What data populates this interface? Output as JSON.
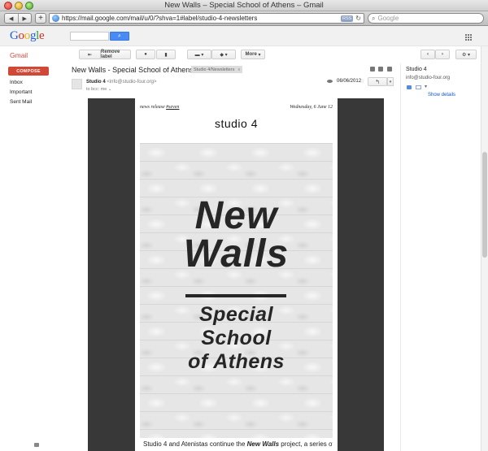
{
  "window": {
    "title": "New Walls – Special School of Athens – Gmail"
  },
  "browser": {
    "back_icon": "triangle-left-icon",
    "forward_icon": "triangle-right-icon",
    "url": "https://mail.google.com/mail/u/0/?shva=1#label/studio-4-newsletters",
    "rss_label": "RSS",
    "search_placeholder": "Google"
  },
  "google": {
    "logo": [
      "G",
      "o",
      "o",
      "g",
      "l",
      "e"
    ]
  },
  "gmail": {
    "app_label": "Gmail",
    "toolbar": {
      "remove_label": "Remove label",
      "more_label": "More"
    },
    "sidebar": {
      "compose_label": "COMPOSE",
      "items": [
        {
          "label": "Inbox"
        },
        {
          "label": "Important"
        },
        {
          "label": "Sent Mail"
        }
      ]
    },
    "message": {
      "subject": "New Walls - Special School of Athens",
      "label_chip": "Studio 4/Newsletters",
      "label_chip_close": "x",
      "sender_name": "Studio 4",
      "sender_email": "<info@studio-four.org>",
      "recipients": "to bcc: me",
      "date": "06/06/2012"
    },
    "contact": {
      "name": "Studio 4",
      "email": "info@studio-four.org",
      "details_link": "Show details"
    }
  },
  "newsletter": {
    "kicker_prefix": "news release ",
    "kicker_number": "#seven",
    "date_line": "Wednesday, 6 June 12",
    "logo_text": "studio 4",
    "headline_1a": "New",
    "headline_1b": "Walls",
    "headline_2a": "Special",
    "headline_2b": "School",
    "headline_2c": "of Athens",
    "body_lead": "Studio 4 and Atenistas continue the ",
    "body_emph": "New Walls",
    "body_tail": " project, a series of murals on school buildings with the participation of Greek and"
  },
  "colors": {
    "compose_red": "#d14836",
    "gmail_red": "#dd4b39",
    "search_blue": "#4a8af4",
    "link_blue": "#1155cc",
    "newsletter_frame": "#383838"
  }
}
